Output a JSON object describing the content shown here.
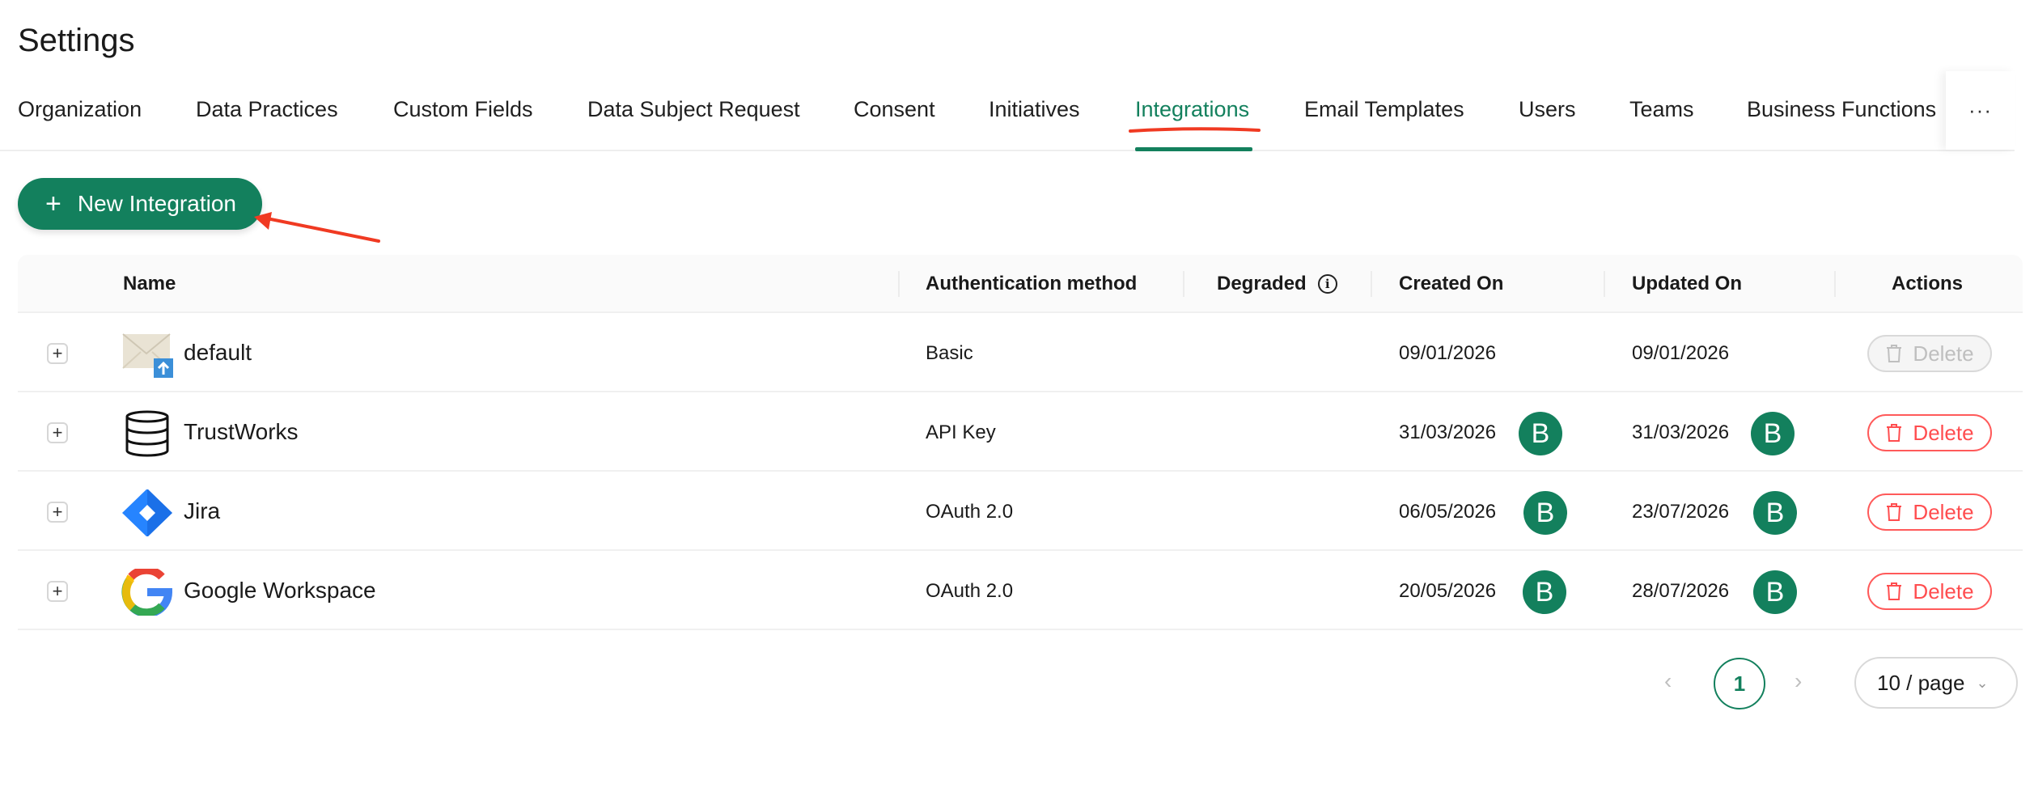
{
  "page": {
    "title": "Settings"
  },
  "tabs": [
    {
      "label": "Organization",
      "active": false
    },
    {
      "label": "Data Practices",
      "active": false
    },
    {
      "label": "Custom Fields",
      "active": false
    },
    {
      "label": "Data Subject Request",
      "active": false
    },
    {
      "label": "Consent",
      "active": false
    },
    {
      "label": "Initiatives",
      "active": false
    },
    {
      "label": "Integrations",
      "active": true
    },
    {
      "label": "Email Templates",
      "active": false
    },
    {
      "label": "Users",
      "active": false
    },
    {
      "label": "Teams",
      "active": false
    },
    {
      "label": "Business Functions",
      "active": false
    }
  ],
  "tabs_more_label": "···",
  "toolbar": {
    "new_integration_label": "New Integration",
    "plus_icon": "+"
  },
  "table": {
    "columns": {
      "name": "Name",
      "auth": "Authentication method",
      "degraded": "Degraded",
      "created": "Created On",
      "updated": "Updated On",
      "actions": "Actions"
    },
    "info_icon": "i",
    "rows": [
      {
        "name": "default",
        "icon": "email-upload-icon",
        "auth": "Basic",
        "created": "09/01/2026",
        "created_by": "",
        "updated": "09/01/2026",
        "updated_by": "",
        "delete_label": "Delete",
        "delete_disabled": true
      },
      {
        "name": "TrustWorks",
        "icon": "database-icon",
        "auth": "API Key",
        "created": "31/03/2026",
        "created_by": "B",
        "updated": "31/03/2026",
        "updated_by": "B",
        "delete_label": "Delete",
        "delete_disabled": false
      },
      {
        "name": "Jira",
        "icon": "jira-logo-icon",
        "auth": "OAuth 2.0",
        "created": "06/05/2026",
        "created_by": "B",
        "updated": "23/07/2026",
        "updated_by": "B",
        "delete_label": "Delete",
        "delete_disabled": false
      },
      {
        "name": "Google Workspace",
        "icon": "google-logo-icon",
        "auth": "OAuth 2.0",
        "created": "20/05/2026",
        "created_by": "B",
        "updated": "28/07/2026",
        "updated_by": "B",
        "delete_label": "Delete",
        "delete_disabled": false
      }
    ]
  },
  "pagination": {
    "prev": "‹",
    "current": "1",
    "next": "›",
    "page_size": "10 / page",
    "chevron": "⌄"
  },
  "colors": {
    "brand": "#13805d",
    "danger": "#ff4d4f",
    "annotation": "#f03a22"
  }
}
